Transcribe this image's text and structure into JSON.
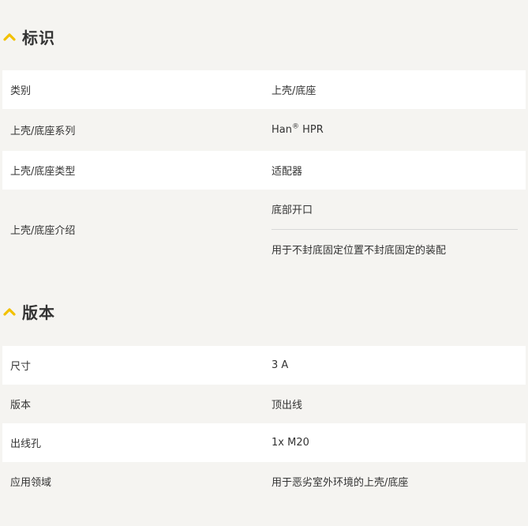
{
  "sections": [
    {
      "title": "标识",
      "rows": [
        {
          "label": "类别",
          "value": "上壳/底座"
        },
        {
          "label": "上壳/底座系列",
          "value_main": "Han",
          "value_sup": "®",
          "value_tail": " HPR"
        },
        {
          "label": "上壳/底座类型",
          "value": "适配器"
        },
        {
          "label": "上壳/底座介绍",
          "values": [
            "底部开口",
            "用于不封底固定位置不封底固定的装配"
          ]
        }
      ]
    },
    {
      "title": "版本",
      "rows": [
        {
          "label": "尺寸",
          "value": "3 A"
        },
        {
          "label": "版本",
          "value": "顶出线"
        },
        {
          "label": "出线孔",
          "value": "1x M20"
        },
        {
          "label": "应用领域",
          "value": "用于恶劣室外环境的上壳/底座"
        }
      ]
    }
  ],
  "colors": {
    "accent": "#f2c100",
    "row_white": "#ffffff",
    "row_grey": "#f5f4f1",
    "text": "#333333"
  },
  "icons": {
    "section_toggle": "chevron-up-icon"
  }
}
